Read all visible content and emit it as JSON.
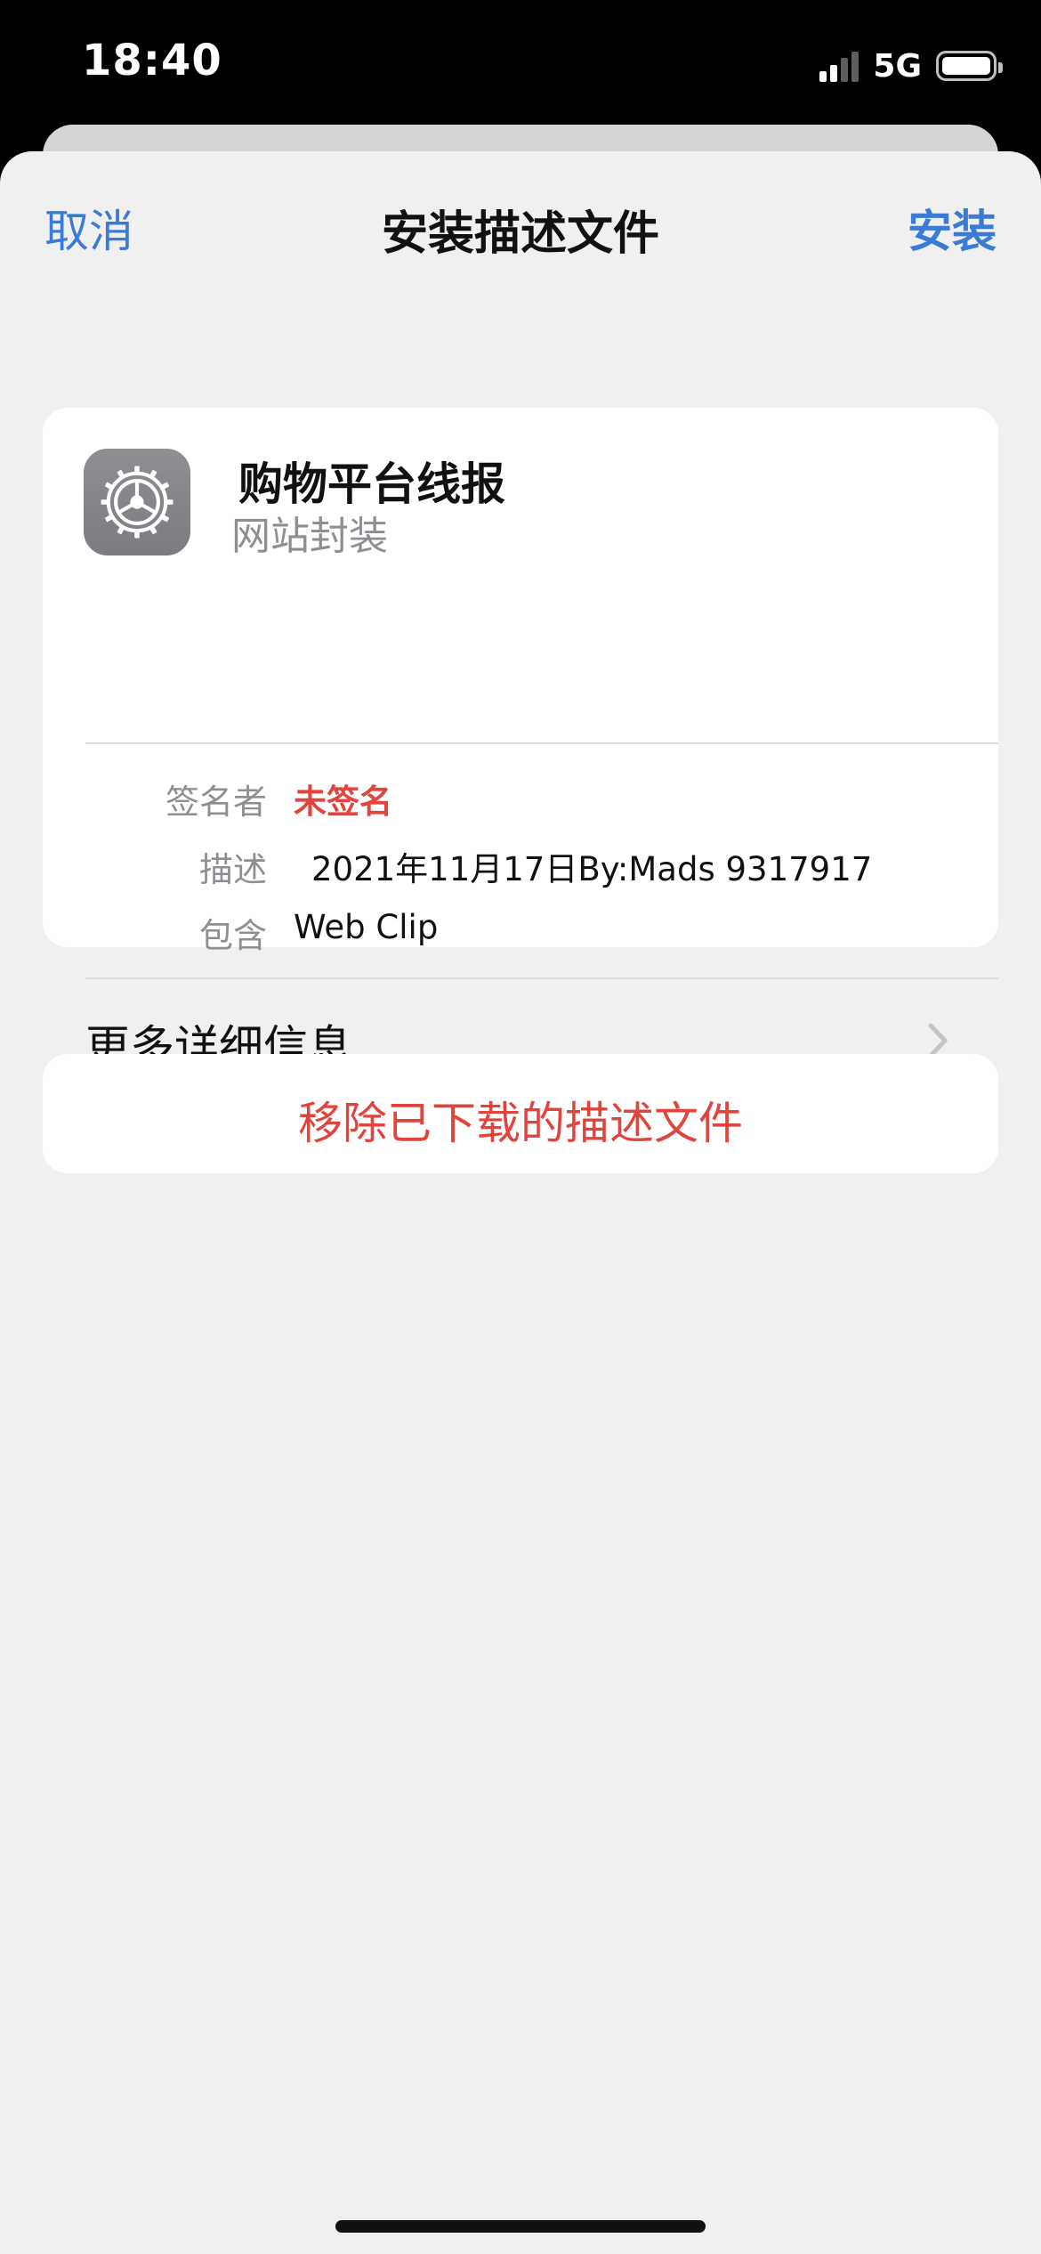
{
  "status_bar": {
    "time": "18:40",
    "network": "5G",
    "signal_bars_active": 2,
    "signal_bars_total": 4
  },
  "nav": {
    "cancel_label": "取消",
    "title": "安装描述文件",
    "install_label": "安装"
  },
  "profile": {
    "icon": "settings-gear-icon",
    "name": "购物平台线报",
    "subtitle": "网站封装",
    "details": {
      "signer_label": "签名者",
      "signer_value": "未签名",
      "description_label": "描述",
      "description_value": "2021年11月17日By:Mads 9317917",
      "contains_label": "包含",
      "contains_value": "Web Clip"
    },
    "more_label": "更多详细信息"
  },
  "remove_label": "移除已下载的描述文件",
  "colors": {
    "accent": "#3a7bd5",
    "destructive": "#e0443c",
    "background": "#f0f0f0",
    "card": "#ffffff",
    "secondary_text": "#8e8e93"
  }
}
